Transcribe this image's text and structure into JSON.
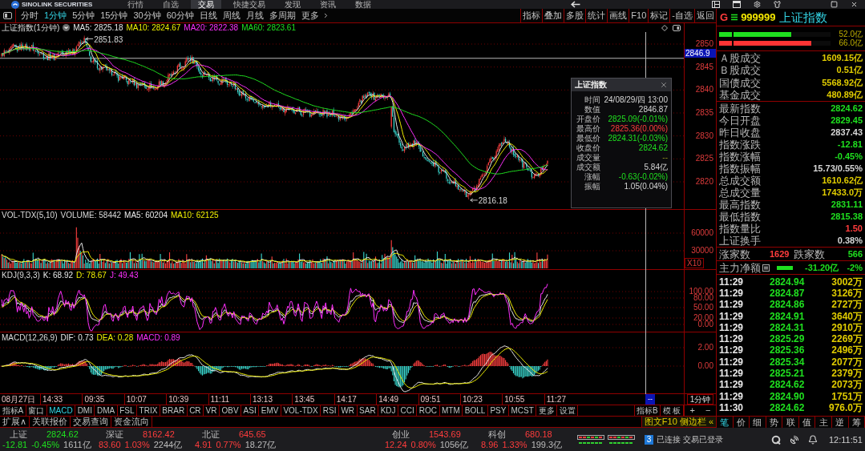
{
  "top_menu": {
    "brand": "SINOLINK SECURITIES",
    "tabs": [
      {
        "label": "行情",
        "selected": false
      },
      {
        "label": "自选",
        "selected": false
      },
      {
        "label": "交易",
        "selected": true
      },
      {
        "label": "快捷交易",
        "selected": false
      },
      {
        "label": "发现",
        "selected": false
      },
      {
        "label": "资讯",
        "selected": false
      },
      {
        "label": "数据",
        "selected": false
      }
    ]
  },
  "period_bar": {
    "periods": [
      {
        "label": "分时",
        "selected": false
      },
      {
        "label": "1分钟",
        "selected": true
      },
      {
        "label": "5分钟",
        "selected": false
      },
      {
        "label": "15分钟",
        "selected": false
      },
      {
        "label": "30分钟",
        "selected": false
      },
      {
        "label": "60分钟",
        "selected": false
      },
      {
        "label": "日线",
        "selected": false
      },
      {
        "label": "周线",
        "selected": false
      },
      {
        "label": "月线",
        "selected": false
      },
      {
        "label": "多周期",
        "selected": false
      },
      {
        "label": "更多",
        "selected": false
      }
    ],
    "tools": [
      "指标",
      "叠加",
      "多股",
      "统计",
      "画线",
      "F10",
      "标记",
      "-自选",
      "返回"
    ]
  },
  "main_chart": {
    "title": "上证指数(1分钟)",
    "ma": [
      {
        "label": "MA5: 2825.18",
        "color": "#e6e6e6"
      },
      {
        "label": "MA10: 2824.67",
        "color": "#f0f000"
      },
      {
        "label": "MA20: 2822.38",
        "color": "#ff30ff"
      },
      {
        "label": "MA60: 2823.61",
        "color": "#20e020"
      }
    ],
    "high_label": "2851.83",
    "low_label": "2816.18",
    "y_labels": [
      "2850",
      "2845",
      "2840",
      "2835",
      "2830",
      "2825",
      "2820"
    ],
    "crosshair_price": "2846.9"
  },
  "tooltip": {
    "title": "上证指数",
    "rows": [
      {
        "label": "时间",
        "value": "24/08/29/四 13:00",
        "kind": "plain"
      },
      {
        "label": "数值",
        "value": "2846.87",
        "kind": "plain"
      },
      {
        "label": "开盘价",
        "value": "2825.09(-0.01%)",
        "kind": "down"
      },
      {
        "label": "最高价",
        "value": "2825.36(0.00%)",
        "kind": "up"
      },
      {
        "label": "最低价",
        "value": "2824.31(-0.03%)",
        "kind": "down"
      },
      {
        "label": "收盘价",
        "value": "2824.62",
        "kind": "down"
      },
      {
        "label": "成交量",
        "value": "--",
        "kind": "dim"
      },
      {
        "label": "成交额",
        "value": "5.84亿",
        "kind": "plain"
      },
      {
        "label": "涨幅",
        "value": "-0.63(-0.02%)",
        "kind": "down"
      },
      {
        "label": "振幅",
        "value": "1.05(0.04%)",
        "kind": "plain"
      }
    ]
  },
  "volume_chart": {
    "title": "VOL-TDX(5,10)",
    "readings": [
      {
        "label": "VOLUME: 58442",
        "color": "#d8d8d8"
      },
      {
        "label": "MA5: 60204",
        "color": "#ececec"
      },
      {
        "label": "MA10: 62125",
        "color": "#f0f000"
      }
    ],
    "y_labels": [
      "60000",
      "30000"
    ],
    "scale": "X10"
  },
  "kdj_chart": {
    "title": "KDJ(9,3,3)",
    "readings": [
      {
        "label": "K: 68.92",
        "color": "#e8e8e8"
      },
      {
        "label": "D: 78.67",
        "color": "#f0f000"
      },
      {
        "label": "J: 49.43",
        "color": "#ff30ff"
      }
    ],
    "y_labels": [
      "100.00",
      "80.00",
      "50.00",
      "20.00",
      "0.00"
    ]
  },
  "macd_chart": {
    "title": "MACD(12,26,9)",
    "readings": [
      {
        "label": "DIF: 0.73",
        "color": "#e8e8e8"
      },
      {
        "label": "DEA: 0.28",
        "color": "#f0f000"
      },
      {
        "label": "MACD: 0.89",
        "color": "#ff30ff"
      }
    ],
    "y_labels": [
      "2.00",
      "0.00"
    ]
  },
  "time_axis": {
    "labels": [
      "08月27日",
      "14:33",
      "09:35",
      "10:07",
      "10:39",
      "11:11",
      "13:13",
      "13:45",
      "14:17",
      "14:49",
      "09:51",
      "10:23",
      "10:55",
      "11:27"
    ],
    "crosshair_time": "--",
    "period": "1分钟"
  },
  "indicator_bar": {
    "tabs": [
      {
        "label": "指标A",
        "selected": false
      },
      {
        "label": "窗口",
        "selected": false
      },
      {
        "label": "MACD",
        "selected": true
      },
      {
        "label": "DMI",
        "selected": false
      },
      {
        "label": "DMA",
        "selected": false
      },
      {
        "label": "FSL",
        "selected": false
      },
      {
        "label": "TRIX",
        "selected": false
      },
      {
        "label": "BRAR",
        "selected": false
      },
      {
        "label": "CR",
        "selected": false
      },
      {
        "label": "VR",
        "selected": false
      },
      {
        "label": "OBV",
        "selected": false
      },
      {
        "label": "ASI",
        "selected": false
      },
      {
        "label": "EMV",
        "selected": false
      },
      {
        "label": "VOL-TDX",
        "selected": false
      },
      {
        "label": "RSI",
        "selected": false
      },
      {
        "label": "WR",
        "selected": false
      },
      {
        "label": "SAR",
        "selected": false
      },
      {
        "label": "KDJ",
        "selected": false
      },
      {
        "label": "CCI",
        "selected": false
      },
      {
        "label": "ROC",
        "selected": false
      },
      {
        "label": "MTM",
        "selected": false
      },
      {
        "label": "BOLL",
        "selected": false
      },
      {
        "label": "PSY",
        "selected": false
      },
      {
        "label": "MCST",
        "selected": false
      },
      {
        "label": "更多",
        "selected": false
      },
      {
        "label": "设置",
        "selected": false
      }
    ],
    "templates": [
      "指标B",
      "模 板"
    ],
    "zoom": [
      "+",
      "−"
    ]
  },
  "extra_bar": {
    "items": [
      "扩展∧",
      "关联报价",
      "交易查询",
      "资金流向"
    ],
    "sidebar": "图文F10 侧边栏 «"
  },
  "quote_panel": {
    "marker": "G",
    "code": "999999",
    "name": "上证指数",
    "flow_bars": [
      {
        "value": "52.0亿",
        "kind": "down",
        "level": 0.65
      },
      {
        "value": "66.0亿",
        "kind": "up",
        "level": 0.83
      }
    ],
    "turnover": [
      {
        "label": "Ａ股成交",
        "value": "1609.15亿",
        "kind": "amount"
      },
      {
        "label": "Ｂ股成交",
        "value": "0.51亿",
        "kind": "amount"
      },
      {
        "label": "国债成交",
        "value": "5568.92亿",
        "kind": "amount"
      },
      {
        "label": "基金成交",
        "value": "480.89亿",
        "kind": "amount"
      }
    ],
    "stats": [
      {
        "label": "最新指数",
        "value": "2824.62",
        "kind": "down"
      },
      {
        "label": "今日开盘",
        "value": "2829.45",
        "kind": "down"
      },
      {
        "label": "昨日收盘",
        "value": "2837.43",
        "kind": "plain"
      },
      {
        "label": "指数涨跌",
        "value": "-12.81",
        "kind": "down"
      },
      {
        "label": "指数涨幅",
        "value": "-0.45%",
        "kind": "down"
      },
      {
        "label": "指数振幅",
        "value": "15.73/0.55%",
        "kind": "plain"
      },
      {
        "label": "总成交额",
        "value": "1610.62亿",
        "kind": "amount"
      },
      {
        "label": "总成交量",
        "value": "17433.0万",
        "kind": "amount"
      },
      {
        "label": "最高指数",
        "value": "2831.11",
        "kind": "down"
      },
      {
        "label": "最低指数",
        "value": "2815.38",
        "kind": "down"
      },
      {
        "label": "指数量比",
        "value": "1.50",
        "kind": "up"
      },
      {
        "label": "上证换手",
        "value": "0.38%",
        "kind": "plain"
      }
    ],
    "breadth": {
      "up_label": "涨家数",
      "up_count": "1629",
      "down_label": "跌家数",
      "down_count": "566"
    },
    "net_flow": {
      "label": "主力净额",
      "value": "-31.20亿",
      "pct": "-2%"
    },
    "ticks": [
      {
        "time": "11:29",
        "price": "2824.94",
        "volume": "3002万"
      },
      {
        "time": "11:29",
        "price": "2824.87",
        "volume": "3126万"
      },
      {
        "time": "11:29",
        "price": "2824.86",
        "volume": "2727万"
      },
      {
        "time": "11:29",
        "price": "2824.91",
        "volume": "3640万"
      },
      {
        "time": "11:29",
        "price": "2824.31",
        "volume": "2910万"
      },
      {
        "time": "11:29",
        "price": "2825.29",
        "volume": "2269万"
      },
      {
        "time": "11:29",
        "price": "2825.36",
        "volume": "2496万"
      },
      {
        "time": "11:29",
        "price": "2825.34",
        "volume": "2077万"
      },
      {
        "time": "11:29",
        "price": "2825.21",
        "volume": "2379万"
      },
      {
        "time": "11:29",
        "price": "2824.62",
        "volume": "2073万"
      },
      {
        "time": "11:29",
        "price": "2824.90",
        "volume": "1751万"
      },
      {
        "time": "11:30",
        "price": "2824.62",
        "volume": "976.0万"
      }
    ],
    "tabs": [
      {
        "label": "笔",
        "selected": true
      },
      {
        "label": "价",
        "selected": false
      },
      {
        "label": "细",
        "selected": false
      },
      {
        "label": "势",
        "selected": false
      },
      {
        "label": "联",
        "selected": false
      },
      {
        "label": "值",
        "selected": false
      },
      {
        "label": "主",
        "selected": false
      },
      {
        "label": "逆",
        "selected": false
      },
      {
        "label": "筹",
        "selected": false
      }
    ]
  },
  "status_bar": {
    "indexes": [
      {
        "name": "上证",
        "price": "2824.62",
        "change": "-12.81",
        "pct": "-0.45%",
        "amount": "1611亿",
        "kind": "down"
      },
      {
        "name": "深证",
        "price": "8162.42",
        "change": "83.60",
        "pct": "1.03%",
        "amount": "2244亿",
        "kind": "up"
      },
      {
        "name": "北证",
        "price": "645.65",
        "change": "4.91",
        "pct": "0.77%",
        "amount": "18.27亿",
        "kind": "up"
      },
      {
        "name": "创业",
        "price": "1543.69",
        "change": "12.24",
        "pct": "0.80%",
        "amount": "1056亿",
        "kind": "up"
      },
      {
        "name": "科创",
        "price": "680.18",
        "change": "8.96",
        "pct": "1.33%",
        "amount": "199.3亿",
        "kind": "up"
      }
    ],
    "badge": "3",
    "connection": "已连接 交易已登录",
    "clock": "12:11:51"
  }
}
